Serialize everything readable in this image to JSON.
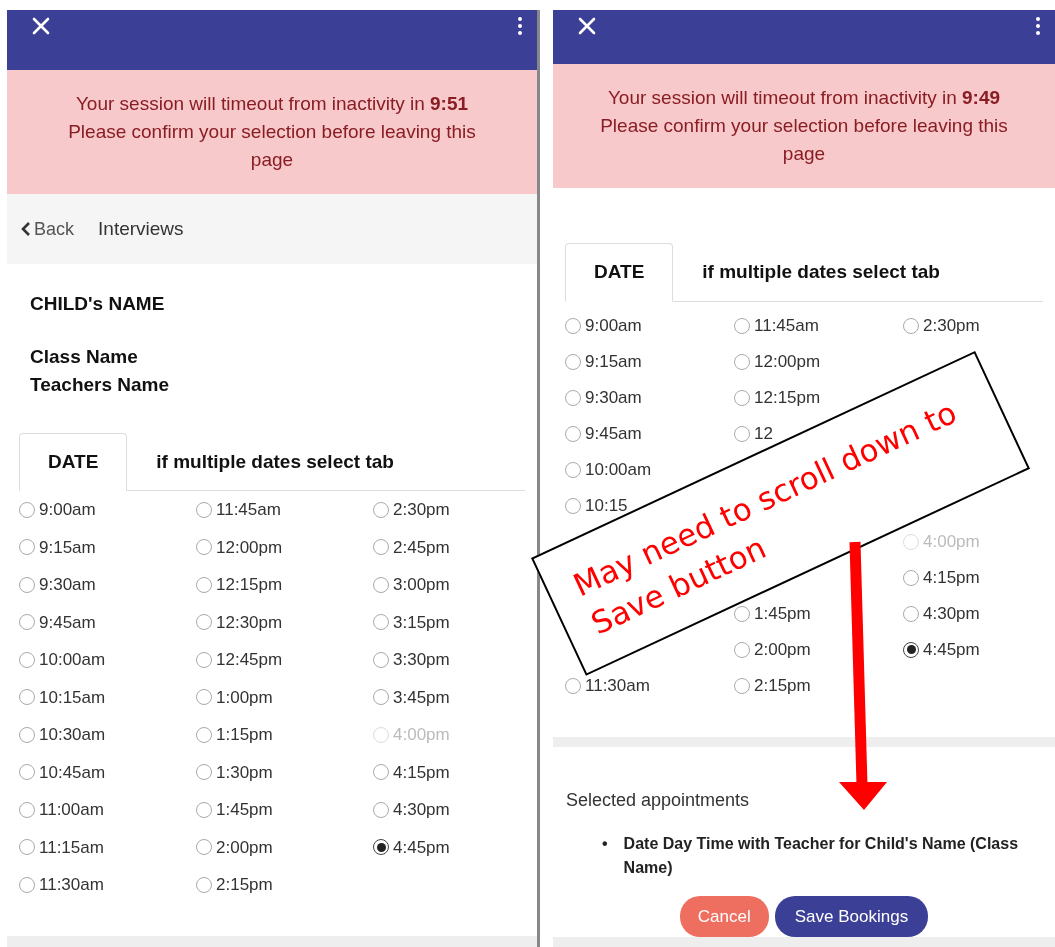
{
  "panels": [
    {
      "alert": {
        "message": "Your session will timeout from inactivity in **9:51**",
        "note": "Please confirm your selection before leaving this page"
      },
      "back_bar": {
        "back": "Back",
        "title": "Interviews"
      },
      "child": {
        "name": "CHILD's NAME",
        "class_name": "Class Name",
        "teacher": "Teachers Name"
      },
      "tabs": [
        {
          "label": "DATE",
          "selected": true
        },
        {
          "label": "if multiple dates select tab",
          "selected": false
        }
      ],
      "time_columns": [
        [
          {
            "label": "9:00am",
            "selected": false,
            "disabled": false
          },
          {
            "label": "9:15am",
            "selected": false,
            "disabled": false
          },
          {
            "label": "9:30am",
            "selected": false,
            "disabled": false
          },
          {
            "label": "9:45am",
            "selected": false,
            "disabled": false
          },
          {
            "label": "10:00am",
            "selected": false,
            "disabled": false
          },
          {
            "label": "10:15am",
            "selected": false,
            "disabled": false
          },
          {
            "label": "10:30am",
            "selected": false,
            "disabled": false
          },
          {
            "label": "10:45am",
            "selected": false,
            "disabled": false
          },
          {
            "label": "11:00am",
            "selected": false,
            "disabled": false
          },
          {
            "label": "11:15am",
            "selected": false,
            "disabled": false
          },
          {
            "label": "11:30am",
            "selected": false,
            "disabled": false
          }
        ],
        [
          {
            "label": "11:45am",
            "selected": false,
            "disabled": false
          },
          {
            "label": "12:00pm",
            "selected": false,
            "disabled": false
          },
          {
            "label": "12:15pm",
            "selected": false,
            "disabled": false
          },
          {
            "label": "12:30pm",
            "selected": false,
            "disabled": false
          },
          {
            "label": "12:45pm",
            "selected": false,
            "disabled": false
          },
          {
            "label": "1:00pm",
            "selected": false,
            "disabled": false
          },
          {
            "label": "1:15pm",
            "selected": false,
            "disabled": false
          },
          {
            "label": "1:30pm",
            "selected": false,
            "disabled": false
          },
          {
            "label": "1:45pm",
            "selected": false,
            "disabled": false
          },
          {
            "label": "2:00pm",
            "selected": false,
            "disabled": false
          },
          {
            "label": "2:15pm",
            "selected": false,
            "disabled": false
          }
        ],
        [
          {
            "label": "2:30pm",
            "selected": false,
            "disabled": false
          },
          {
            "label": "2:45pm",
            "selected": false,
            "disabled": false
          },
          {
            "label": "3:00pm",
            "selected": false,
            "disabled": false
          },
          {
            "label": "3:15pm",
            "selected": false,
            "disabled": false
          },
          {
            "label": "3:30pm",
            "selected": false,
            "disabled": false
          },
          {
            "label": "3:45pm",
            "selected": false,
            "disabled": false
          },
          {
            "label": "4:00pm",
            "selected": false,
            "disabled": true
          },
          {
            "label": "4:15pm",
            "selected": false,
            "disabled": false
          },
          {
            "label": "4:30pm",
            "selected": false,
            "disabled": false
          },
          {
            "label": "4:45pm",
            "selected": true,
            "disabled": false
          }
        ]
      ]
    },
    {
      "alert": {
        "message": "Your session will timeout from inactivity in **9:49**",
        "note": "Please confirm your selection before leaving this page"
      },
      "tabs": [
        {
          "label": "DATE",
          "selected": true
        },
        {
          "label": "if multiple dates select tab",
          "selected": false
        }
      ],
      "time_columns": [
        [
          {
            "label": "9:00am",
            "selected": false,
            "disabled": false
          },
          {
            "label": "9:15am",
            "selected": false,
            "disabled": false
          },
          {
            "label": "9:30am",
            "selected": false,
            "disabled": false
          },
          {
            "label": "9:45am",
            "selected": false,
            "disabled": false
          },
          {
            "label": "10:00am",
            "selected": false,
            "disabled": false
          },
          {
            "label": "10:15",
            "selected": false,
            "disabled": false
          },
          null,
          null,
          null,
          null,
          {
            "label": "11:30am",
            "selected": false,
            "disabled": false
          }
        ],
        [
          {
            "label": "11:45am",
            "selected": false,
            "disabled": false
          },
          {
            "label": "12:00pm",
            "selected": false,
            "disabled": false
          },
          {
            "label": "12:15pm",
            "selected": false,
            "disabled": false
          },
          {
            "label": "12",
            "selected": false,
            "disabled": false
          },
          null,
          null,
          null,
          null,
          {
            "label": "1:45pm",
            "selected": false,
            "disabled": false
          },
          {
            "label": "2:00pm",
            "selected": false,
            "disabled": false
          },
          {
            "label": "2:15pm",
            "selected": false,
            "disabled": false
          }
        ],
        [
          {
            "label": "2:30pm",
            "selected": false,
            "disabled": false
          },
          null,
          null,
          null,
          null,
          null,
          {
            "label": "4:00pm",
            "selected": false,
            "disabled": true
          },
          {
            "label": "4:15pm",
            "selected": false,
            "disabled": false
          },
          {
            "label": "4:30pm",
            "selected": false,
            "disabled": false
          },
          {
            "label": "4:45pm",
            "selected": true,
            "disabled": false
          }
        ]
      ],
      "selected_appointments": {
        "heading": "Selected appointments",
        "bullet": "•",
        "items": [
          "Date Day Time with Teacher for Child's Name (Class Name)"
        ]
      },
      "buttons": [
        {
          "label": "Cancel",
          "kind": "cancel"
        },
        {
          "label": "Save Bookings",
          "kind": "save"
        }
      ]
    }
  ],
  "annotation": {
    "text": "May need to scroll down to Save button"
  }
}
